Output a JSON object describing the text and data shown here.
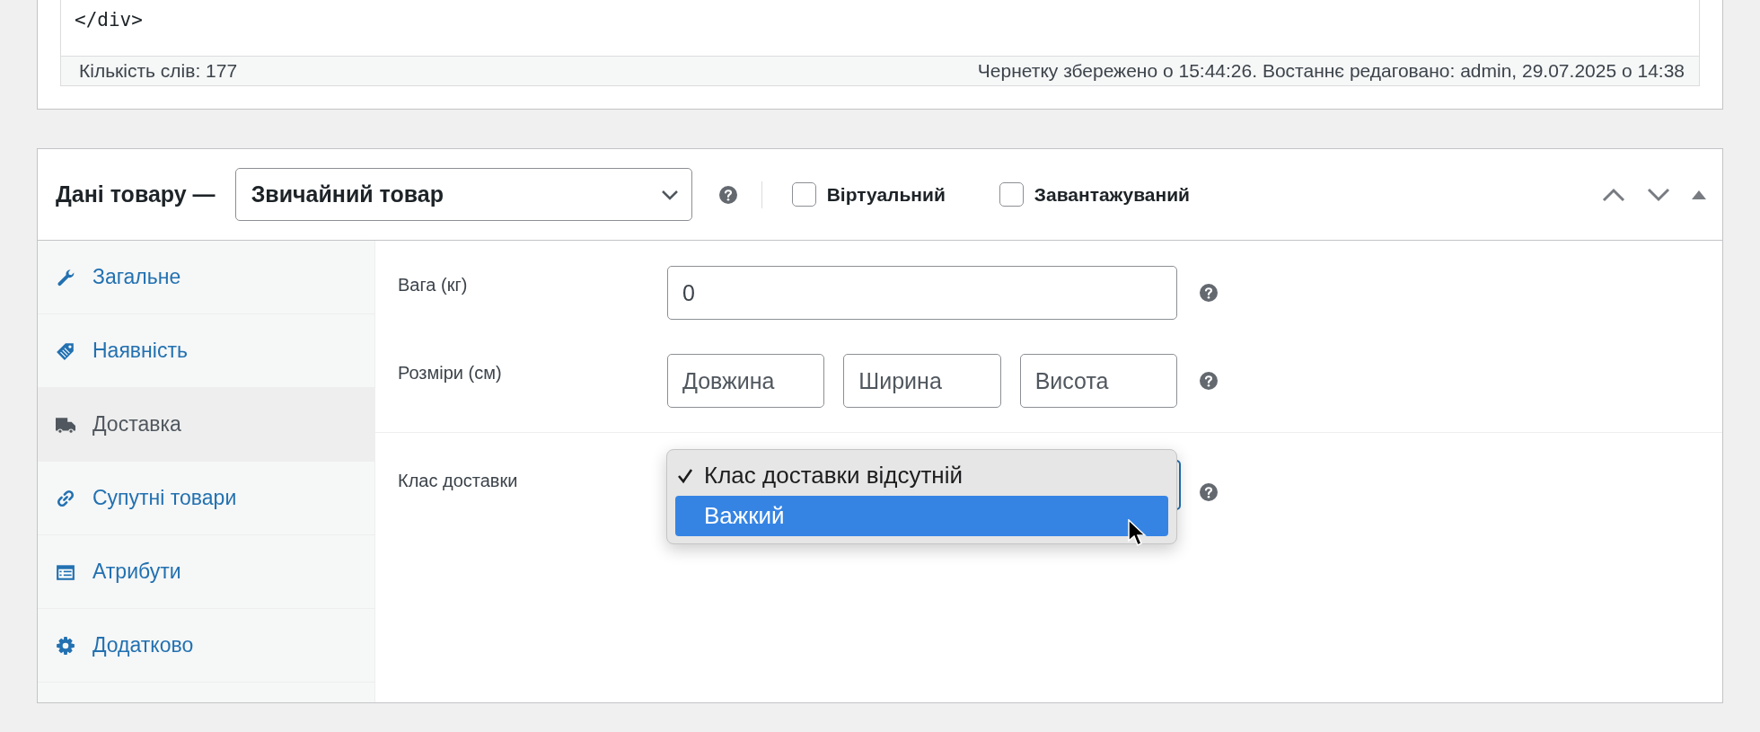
{
  "editor": {
    "code_line": "</div>",
    "status_bar": {
      "word_count": "Кількість слів: 177",
      "draft_status": "Чернетку збережено о 15:44:26. Востаннє редаговано: admin, 29.07.2025 о 14:38"
    }
  },
  "product_data": {
    "title": "Дані товару —",
    "product_type": "Звичайний товар",
    "options": [
      {
        "label": "Віртуальний",
        "checked": false
      },
      {
        "label": "Завантажуваний",
        "checked": false
      }
    ],
    "tabs": [
      {
        "label": "Загальне",
        "selected": false
      },
      {
        "label": "Наявність",
        "selected": false
      },
      {
        "label": "Доставка",
        "selected": true
      },
      {
        "label": "Супутні товари",
        "selected": false
      },
      {
        "label": "Атрибути",
        "selected": false
      },
      {
        "label": "Додатково",
        "selected": false
      }
    ],
    "fields": [
      {
        "label": "Вага (кг)",
        "inputs": [
          {
            "value": "0"
          }
        ]
      },
      {
        "label": "Розміри (см)",
        "inputs": [
          {
            "placeholder": "Довжина"
          },
          {
            "placeholder": "Ширина"
          },
          {
            "placeholder": "Висота"
          }
        ]
      }
    ],
    "shipping_class": {
      "label": "Клас доставки",
      "expanded": true,
      "options": [
        {
          "label": "Клас доставки відсутній",
          "checked": true,
          "highlighted": false
        },
        {
          "label": "Важкий",
          "checked": false,
          "highlighted": true
        }
      ]
    }
  }
}
